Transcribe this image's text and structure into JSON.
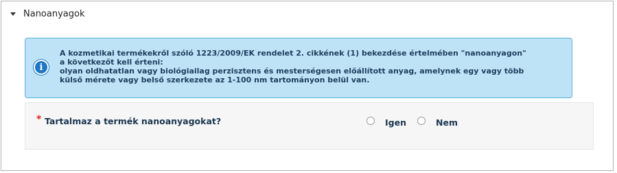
{
  "section": {
    "title": "Nanoanyagok",
    "caret_icon": "caret-down-icon"
  },
  "info": {
    "icon": "info-icon",
    "icon_glyph": "i",
    "lines": [
      "A kozmetikai termékekről szóló 1223/2009/EK rendelet 2. cikkének (1) bekezdése értelmében \"nanoanyagon\"",
      "a következőt kell érteni:",
      "olyan oldhatatlan vagy biológiailag perzisztens és mesterségesen előállított anyag, amelynek egy vagy több",
      "külső mérete vagy belső szerkezete az 1-100 nm tartományon belül van."
    ],
    "colors": {
      "background": "#bfe3f6",
      "border": "#5aaedb",
      "text": "#1d3d5e"
    }
  },
  "question": {
    "required_marker": "*",
    "label": "Tartalmaz a termék nanoanyagokat?",
    "options": [
      {
        "label": "Igen",
        "selected": false
      },
      {
        "label": "Nem",
        "selected": false
      }
    ]
  }
}
